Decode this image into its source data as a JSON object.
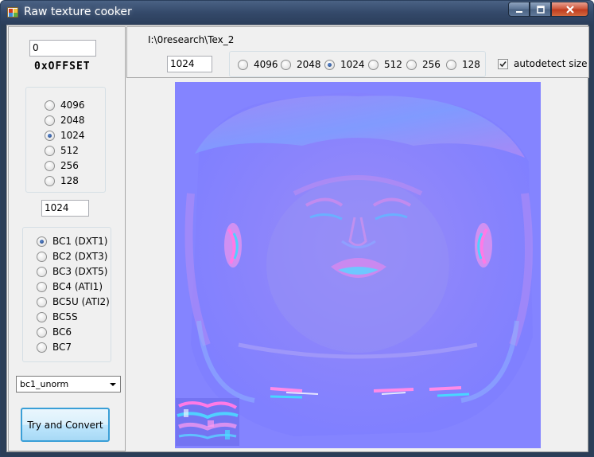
{
  "window": {
    "title": "Raw texture cooker",
    "icon": "app-grid-icon"
  },
  "caption": {
    "minimize_icon": "minimize-icon",
    "maximize_icon": "maximize-icon",
    "close_icon": "close-icon"
  },
  "left": {
    "offset_value": "0",
    "offset_label": "0xOFFSET",
    "sizes": [
      "4096",
      "2048",
      "1024",
      "512",
      "256",
      "128"
    ],
    "size_selected": "1024",
    "size_value": "1024",
    "formats": [
      "BC1 (DXT1)",
      "BC2 (DXT3)",
      "BC3 (DXT5)",
      "BC4 (ATI1)",
      "BC5U (ATI2)",
      "BC5S",
      "BC6",
      "BC7"
    ],
    "format_selected": "BC1 (DXT1)",
    "dxgi_selected": "bc1_unorm",
    "convert_label": "Try and Convert"
  },
  "top": {
    "path": "I:\\0research\\Tex_2",
    "width_value": "1024",
    "sizes": [
      "4096",
      "2048",
      "1024",
      "512",
      "256",
      "128"
    ],
    "size_selected": "1024",
    "autodetect_label": "autodetect size",
    "autodetect_checked": true
  },
  "colors": {
    "normal_map_base": "#8080ff",
    "button_border": "#3a9fd7",
    "titlebar": "#34496a"
  }
}
